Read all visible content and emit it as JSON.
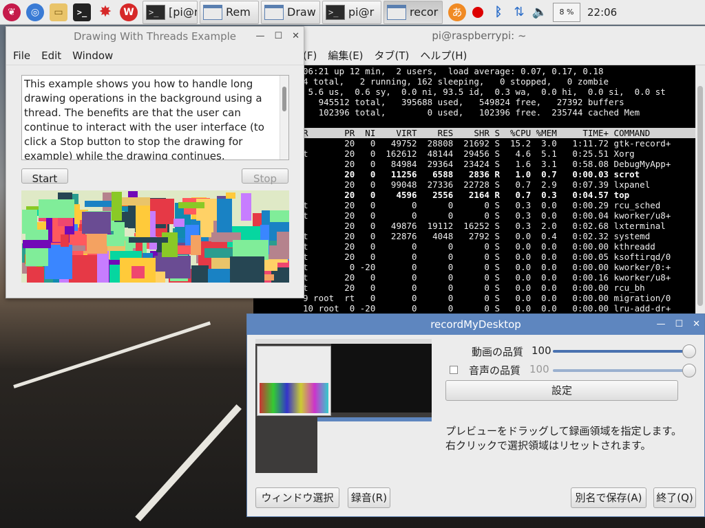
{
  "taskbar": {
    "tasks": [
      {
        "label": "[pi@r",
        "type": "term"
      },
      {
        "label": "Rem",
        "type": "win"
      },
      {
        "label": "Draw",
        "type": "win"
      },
      {
        "label": "pi@r",
        "type": "term"
      },
      {
        "label": "recor",
        "type": "win"
      }
    ],
    "ime": "あ",
    "cpu": "8 %",
    "clock": "22:06",
    "icons": [
      "raspberry-menu-icon",
      "web-browser-icon",
      "file-manager-icon",
      "terminal-icon",
      "math-icon",
      "wolfram-icon",
      "ime-icon",
      "record-indicator-icon",
      "bluetooth-icon",
      "network-updown-icon",
      "volume-icon"
    ]
  },
  "terminal": {
    "title": "pi@raspberrypi: ~",
    "menu": [
      "(F)",
      "編集(E)",
      "タブ(T)",
      "ヘルプ(H)"
    ],
    "summary": [
      "06:21 up 12 min,  2 users,  load average: 0.07, 0.17, 0.18",
      "4 total,   2 running, 162 sleeping,   0 stopped,   0 zombie",
      " 5.6 us,  0.6 sy,  0.0 ni, 93.5 id,  0.3 wa,  0.0 hi,  0.0 si,  0.0 st",
      "   945512 total,   395688 used,   549824 free,   27392 buffers",
      "   102396 total,        0 used,   102396 free.  235744 cached Mem"
    ],
    "header": "R       PR  NI    VIRT    RES    SHR S  %CPU %MEM     TIME+ COMMAND",
    "rows": [
      {
        "text": "        20   0   49752  28808  21692 S  15.2  3.0   1:11.72 gtk-record+",
        "bold": false
      },
      {
        "text": "t       20   0  162612  48144  29456 S   4.6  5.1   0:25.51 Xorg",
        "bold": false
      },
      {
        "text": "        20   0   84984  29364  23424 S   1.6  3.1   0:58.08 DebugMyApp+",
        "bold": false
      },
      {
        "text": "        20   0   11256   6588   2836 R   1.0  0.7   0:00.03 scrot",
        "bold": true
      },
      {
        "text": "        20   0   99048  27336  22728 S   0.7  2.9   0:07.39 lxpanel",
        "bold": false
      },
      {
        "text": "        20   0    4596   2556   2164 R   0.7  0.3   0:04.57 top",
        "bold": true
      },
      {
        "text": "t       20   0       0      0      0 S   0.3  0.0   0:00.29 rcu_sched",
        "bold": false
      },
      {
        "text": "t       20   0       0      0      0 S   0.3  0.0   0:00.04 kworker/u8+",
        "bold": false
      },
      {
        "text": "        20   0   49876  19112  16252 S   0.3  2.0   0:02.68 lxterminal",
        "bold": false
      },
      {
        "text": "t       20   0   22876   4048   2792 S   0.0  0.4   0:02.32 systemd",
        "bold": false
      },
      {
        "text": "t       20   0       0      0      0 S   0.0  0.0   0:00.00 kthreadd",
        "bold": false
      },
      {
        "text": "t       20   0       0      0      0 S   0.0  0.0   0:00.05 ksoftirqd/0",
        "bold": false
      },
      {
        "text": "t        0 -20       0      0      0 S   0.0  0.0   0:00.00 kworker/0:+",
        "bold": false
      },
      {
        "text": "t       20   0       0      0      0 S   0.0  0.0   0:00.16 kworker/u8+",
        "bold": false
      },
      {
        "text": "t       20   0       0      0      0 S   0.0  0.0   0:00.00 rcu_bh",
        "bold": false
      },
      {
        "text": "9 root  rt   0       0      0      0 S   0.0  0.0   0:00.00 migration/0",
        "bold": false
      },
      {
        "text": "10 root  0 -20       0      0      0 S   0.0  0.0   0:00.00 lru-add-dr+",
        "bold": false
      }
    ]
  },
  "drawing": {
    "title": "Drawing With Threads Example",
    "menu": [
      "File",
      "Edit",
      "Window"
    ],
    "description": "This example shows you how to handle long drawing operations in the background using a thread. The benefits are that the user can continue to interact with the user interface (to click a Stop button to stop the drawing for example) while the drawing continues.",
    "start_label": "Start",
    "stop_label": "Stop"
  },
  "record": {
    "title": "recordMyDesktop",
    "video_quality_label": "動画の品質",
    "video_quality_value": "100",
    "audio_quality_label": "音声の品質",
    "audio_quality_value": "100",
    "audio_enabled": false,
    "settings_label": "設定",
    "info_line1": "プレビューをドラッグして録画領域を指定します。",
    "info_line2": "右クリックで選択領域はリセットされます。",
    "select_window_label": "ウィンドウ選択",
    "record_label": "録音(R)",
    "save_as_label": "別名で保存(A)",
    "quit_label": "終了(Q)"
  },
  "colors": {
    "accent": "#5e86bf",
    "terminal_bg": "#000000",
    "panel": "#ececec"
  }
}
